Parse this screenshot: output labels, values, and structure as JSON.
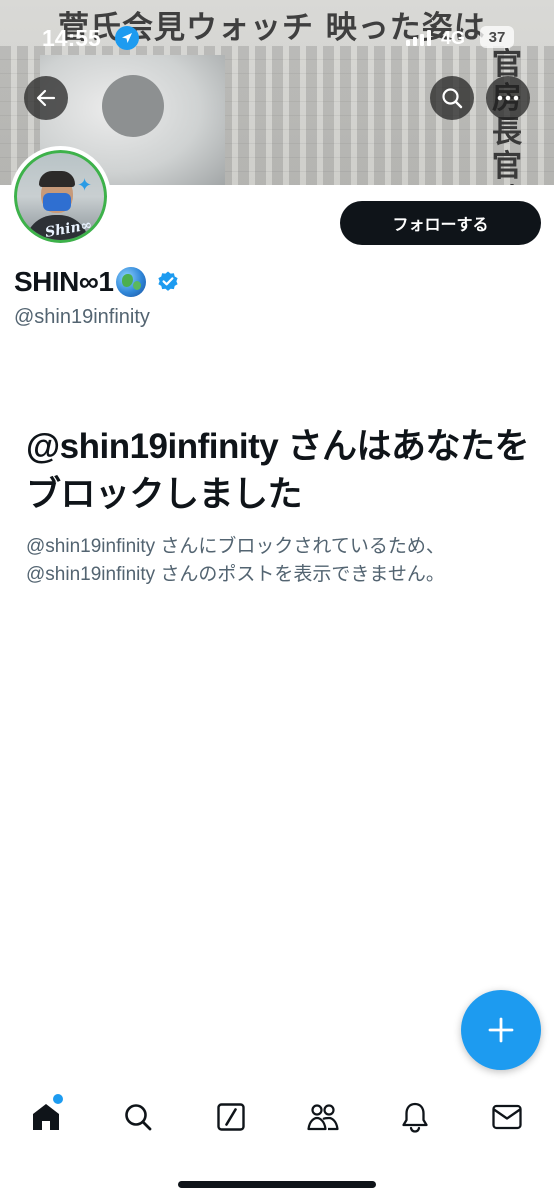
{
  "status_bar": {
    "time": "14:55",
    "network": "4G",
    "battery": "37"
  },
  "banner": {
    "headline": "菅氏会見ウォッチ 映った姿は",
    "side_title": "官房長官時代"
  },
  "profile": {
    "display_name": "SHIN∞1",
    "handle": "@shin19infinity",
    "follow_label": "フォローする",
    "avatar_signature": "Shin∞",
    "verified": true
  },
  "blocked": {
    "title": "@shin19infinity さんはあなたをブロックしました",
    "description": "@shin19infinity さんにブロックされているため、@shin19infinity さんのポストを表示できません。"
  },
  "icons": {
    "back": "arrow-left-icon",
    "search": "search-icon",
    "more": "more-icon",
    "compose": "plus-icon",
    "nav": [
      "home-icon",
      "search-icon",
      "grok-icon",
      "communities-icon",
      "notifications-icon",
      "messages-icon"
    ]
  },
  "colors": {
    "accent": "#1d9bf0",
    "text": "#0f1419",
    "secondary_text": "#536471",
    "follow_button": "#0f1419"
  }
}
